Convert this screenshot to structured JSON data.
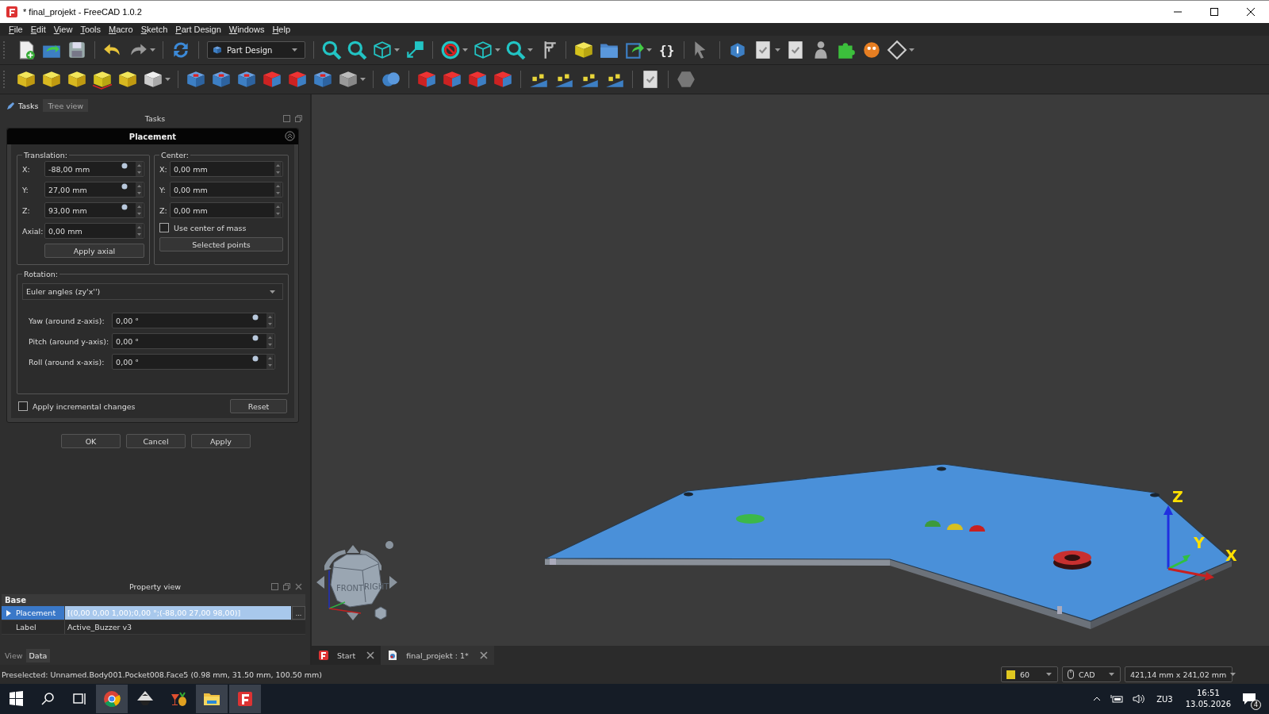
{
  "window": {
    "title": "* final_projekt - FreeCAD 1.0.2"
  },
  "menu": [
    "File",
    "Edit",
    "View",
    "Tools",
    "Macro",
    "Sketch",
    "Part Design",
    "Windows",
    "Help"
  ],
  "toolbar": {
    "workbench": "Part Design",
    "braces_button": "{}"
  },
  "panel_tabs": [
    {
      "label": "Tasks",
      "selected": true
    },
    {
      "label": "Tree view",
      "selected": false
    }
  ],
  "tasks_header": "Tasks",
  "placement": {
    "title": "Placement",
    "translation": {
      "legend": "Translation:",
      "rows": [
        {
          "label": "X:",
          "value": "-88,00 mm",
          "expression": true
        },
        {
          "label": "Y:",
          "value": "27,00 mm",
          "expression": true
        },
        {
          "label": "Z:",
          "value": "93,00 mm",
          "expression": true
        },
        {
          "label": "Axial:",
          "value": "0,00 mm",
          "expression": false
        }
      ],
      "button": "Apply axial"
    },
    "center": {
      "legend": "Center:",
      "rows": [
        {
          "label": "X:",
          "value": "0,00 mm",
          "expression": false
        },
        {
          "label": "Y:",
          "value": "0,00 mm",
          "expression": false
        },
        {
          "label": "Z:",
          "value": "0,00 mm",
          "expression": false
        }
      ],
      "use_center_of_mass": {
        "label": "Use center of mass",
        "checked": false
      },
      "button": "Selected points"
    },
    "rotation": {
      "legend": "Rotation:",
      "mode": "Euler angles (zy'x'')",
      "rows": [
        {
          "label": "Yaw (around z-axis):",
          "value": "0,00 °",
          "expression": true
        },
        {
          "label": "Pitch (around y-axis):",
          "value": "0,00 °",
          "expression": true
        },
        {
          "label": "Roll (around x-axis):",
          "value": "0,00 °",
          "expression": true
        }
      ]
    },
    "incremental": {
      "label": "Apply incremental changes",
      "checked": false
    },
    "reset": "Reset"
  },
  "dialog_buttons": [
    "OK",
    "Cancel",
    "Apply"
  ],
  "property_view": {
    "title": "Property view",
    "group": "Base",
    "rows": [
      {
        "name": "Placement",
        "value": "[(0,00 0,00 1,00);0,00 °;(-88,00 27,00 98,00)]",
        "selected": true,
        "expandable": true,
        "edit_button": "..."
      },
      {
        "name": "Label",
        "value": "Active_Buzzer v3",
        "selected": false,
        "expandable": false
      }
    ],
    "tabs": [
      {
        "label": "View",
        "selected": false
      },
      {
        "label": "Data",
        "selected": true
      }
    ]
  },
  "viewport": {
    "nav_cube": [
      "FRONT",
      "RIGHT"
    ],
    "axes": [
      "Z",
      "Y",
      "X"
    ]
  },
  "document_tabs": [
    {
      "label": "Start",
      "kind": "start",
      "selected": false
    },
    {
      "label": "final_projekt : 1*",
      "kind": "document",
      "selected": true
    }
  ],
  "status_bar": {
    "message": "Preselected: Unnamed.Body001.Pocket008.Face5 (0.98 mm, 31.50 mm, 100.50 mm)",
    "draw_style": "60",
    "navigation": "CAD",
    "dimensions": "421,14 mm x 241,02 mm"
  },
  "taskbar": {
    "apps": [
      {
        "kind": "browser",
        "open": true
      },
      {
        "kind": "vector",
        "open": false
      },
      {
        "kind": "drinks",
        "open": false
      },
      {
        "kind": "files",
        "open": true
      },
      {
        "kind": "cad",
        "open": true
      }
    ],
    "language": "ZU3",
    "time": "16:51",
    "date": "13.05.2026",
    "notifications": "4"
  }
}
